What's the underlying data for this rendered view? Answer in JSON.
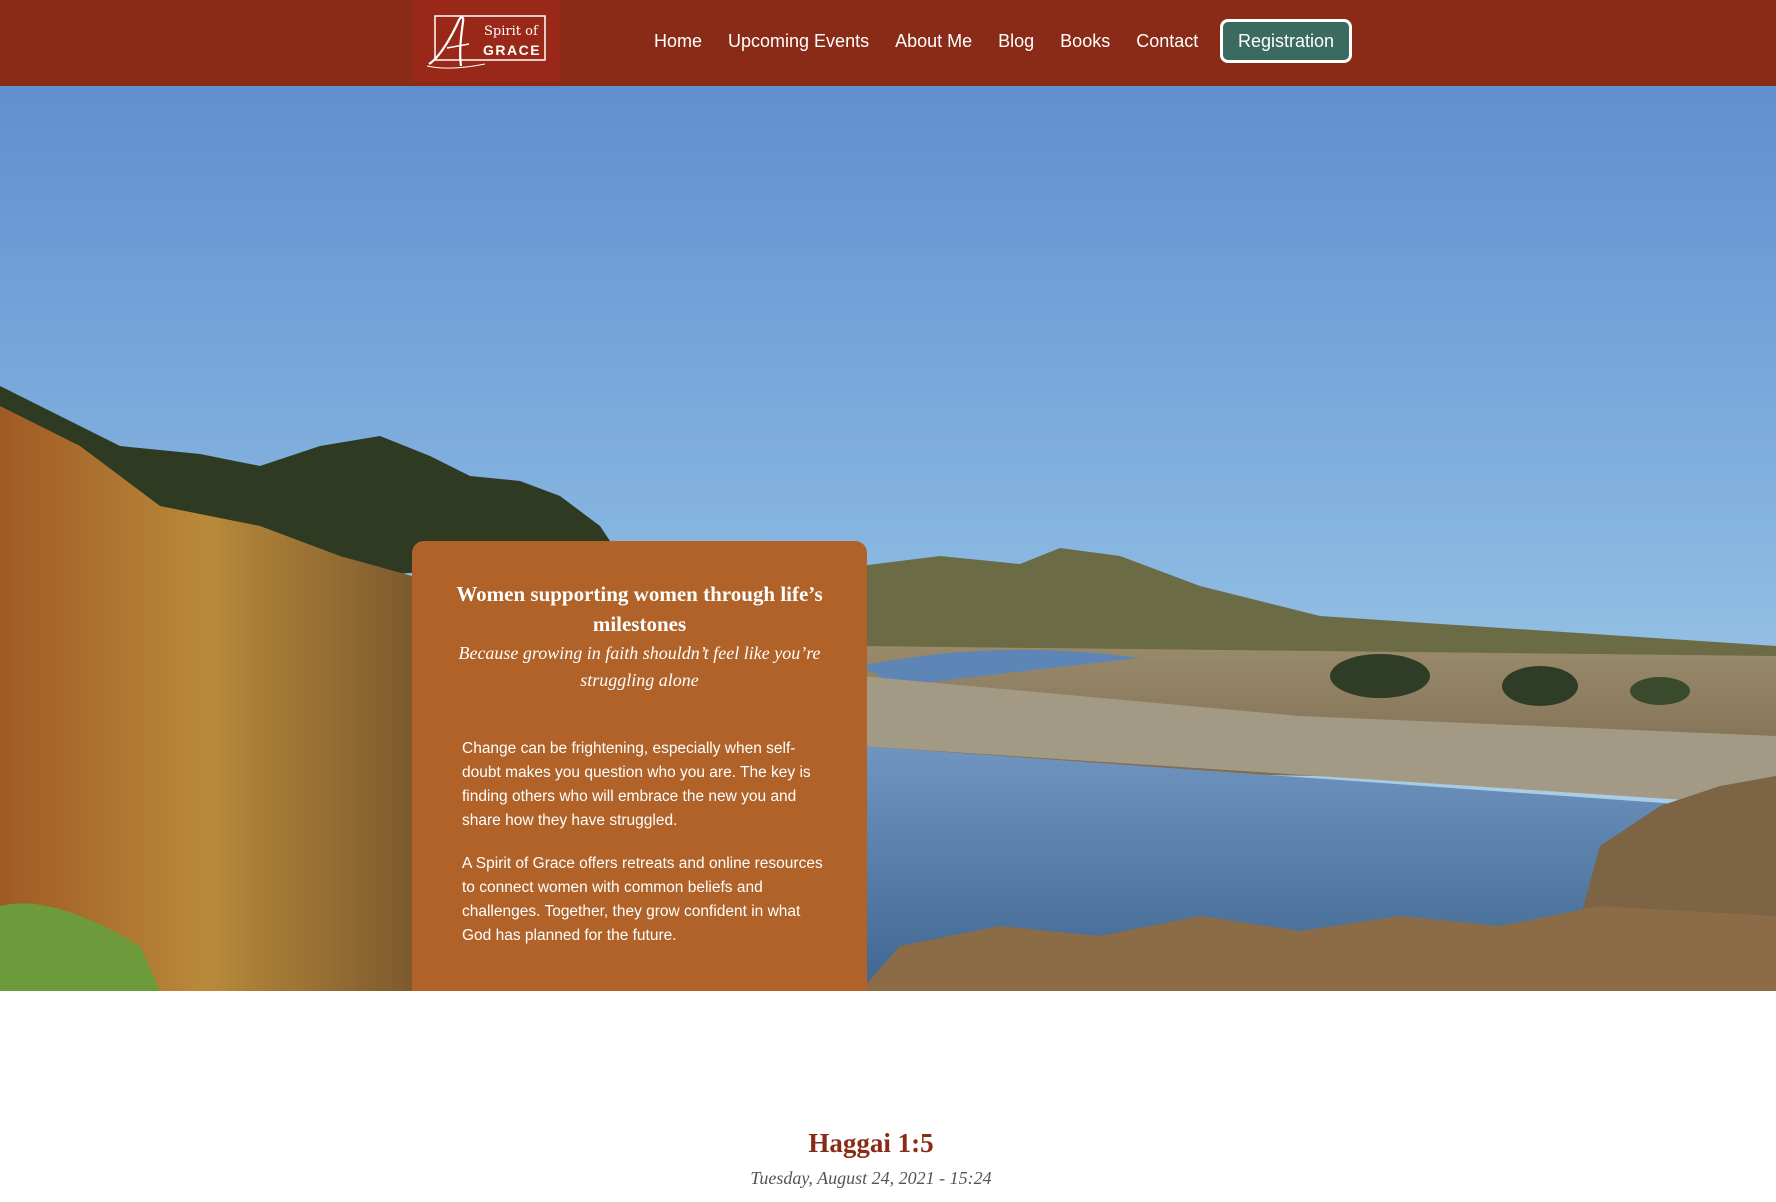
{
  "header": {
    "logo": {
      "word_top": "Spirit of",
      "word_bottom": "GRACE",
      "initial": "A"
    },
    "nav": [
      "Home",
      "Upcoming Events",
      "About Me",
      "Blog",
      "Books",
      "Contact"
    ],
    "registration_label": "Registration",
    "colors": {
      "bar": "#8a2b18",
      "button": "#3b6b60"
    }
  },
  "hero": {
    "image": "coastal-river-landscape",
    "card": {
      "title": "Women supporting women through life’s milestones",
      "subtitle": "Because growing in faith shouldn’t feel like you’re struggling alone",
      "paragraph_1": "Change can be frightening, especially when self-doubt makes you question who you are. The key is finding others who will embrace the new you and share how they have struggled.",
      "paragraph_2": "A Spirit of Grace offers retreats and online resources to connect women with common beliefs and challenges. Together, they grow confident in what God has planned for the future.",
      "color": "#b06228"
    }
  },
  "post": {
    "title": "Haggai 1:5",
    "date": "Tuesday, August 24, 2021 - 15:24"
  }
}
